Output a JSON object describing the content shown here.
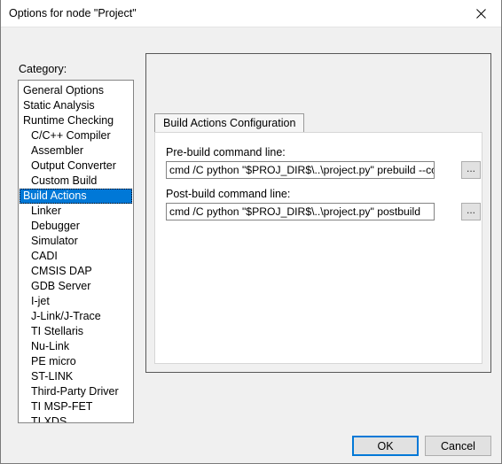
{
  "window": {
    "title": "Options for node \"Project\"",
    "close_icon": "close-icon"
  },
  "category": {
    "label": "Category:",
    "items": [
      {
        "label": "General Options",
        "indent": false,
        "selected": false
      },
      {
        "label": "Static Analysis",
        "indent": false,
        "selected": false
      },
      {
        "label": "Runtime Checking",
        "indent": false,
        "selected": false
      },
      {
        "label": "C/C++ Compiler",
        "indent": true,
        "selected": false
      },
      {
        "label": "Assembler",
        "indent": true,
        "selected": false
      },
      {
        "label": "Output Converter",
        "indent": true,
        "selected": false
      },
      {
        "label": "Custom Build",
        "indent": true,
        "selected": false
      },
      {
        "label": "Build Actions",
        "indent": true,
        "selected": true
      },
      {
        "label": "Linker",
        "indent": true,
        "selected": false
      },
      {
        "label": "Debugger",
        "indent": true,
        "selected": false
      },
      {
        "label": "Simulator",
        "indent": true,
        "selected": false,
        "sub": true
      },
      {
        "label": "CADI",
        "indent": true,
        "selected": false,
        "sub": true
      },
      {
        "label": "CMSIS DAP",
        "indent": true,
        "selected": false,
        "sub": true
      },
      {
        "label": "GDB Server",
        "indent": true,
        "selected": false,
        "sub": true
      },
      {
        "label": "I-jet",
        "indent": true,
        "selected": false,
        "sub": true
      },
      {
        "label": "J-Link/J-Trace",
        "indent": true,
        "selected": false,
        "sub": true
      },
      {
        "label": "TI Stellaris",
        "indent": true,
        "selected": false,
        "sub": true
      },
      {
        "label": "Nu-Link",
        "indent": true,
        "selected": false,
        "sub": true
      },
      {
        "label": "PE micro",
        "indent": true,
        "selected": false,
        "sub": true
      },
      {
        "label": "ST-LINK",
        "indent": true,
        "selected": false,
        "sub": true
      },
      {
        "label": "Third-Party Driver",
        "indent": true,
        "selected": false,
        "sub": true
      },
      {
        "label": "TI MSP-FET",
        "indent": true,
        "selected": false,
        "sub": true
      },
      {
        "label": "TI XDS",
        "indent": true,
        "selected": false,
        "sub": true
      }
    ]
  },
  "panel": {
    "tab_label": "Build Actions Configuration",
    "prebuild": {
      "label": "Pre-build command line:",
      "value": "cmd /C python \"$PROJ_DIR$\\..\\project.py\" prebuild --compiler IAR\"",
      "browse_label": "..."
    },
    "postbuild": {
      "label": "Post-build command line:",
      "value": "cmd /C python \"$PROJ_DIR$\\..\\project.py\" postbuild",
      "browse_label": "..."
    }
  },
  "footer": {
    "ok_label": "OK",
    "cancel_label": "Cancel"
  },
  "colors": {
    "selection": "#0078d7",
    "dialog_bg": "#f0f0f0",
    "field_bg": "#ffffff"
  }
}
